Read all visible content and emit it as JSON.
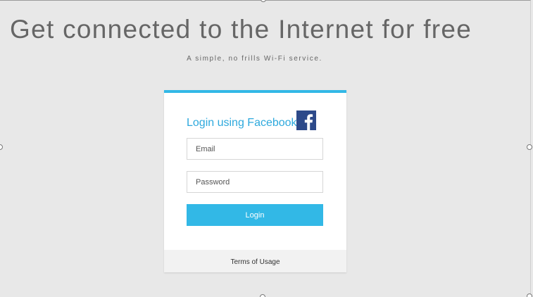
{
  "page": {
    "headline": "Get connected to the Internet for free",
    "tagline": "A simple, no frills Wi-Fi service."
  },
  "login_card": {
    "facebook_label": "Login using Facebook",
    "facebook_icon": "facebook-logo-icon",
    "email": {
      "placeholder": "Email",
      "value": ""
    },
    "password": {
      "placeholder": "Password",
      "value": ""
    },
    "login_button_label": "Login",
    "terms_label": "Terms of Usage"
  },
  "colors": {
    "accent": "#32b8e6",
    "facebook_blue": "#2d4a8a",
    "background": "#e8e8e8",
    "headline_text": "#666666"
  }
}
